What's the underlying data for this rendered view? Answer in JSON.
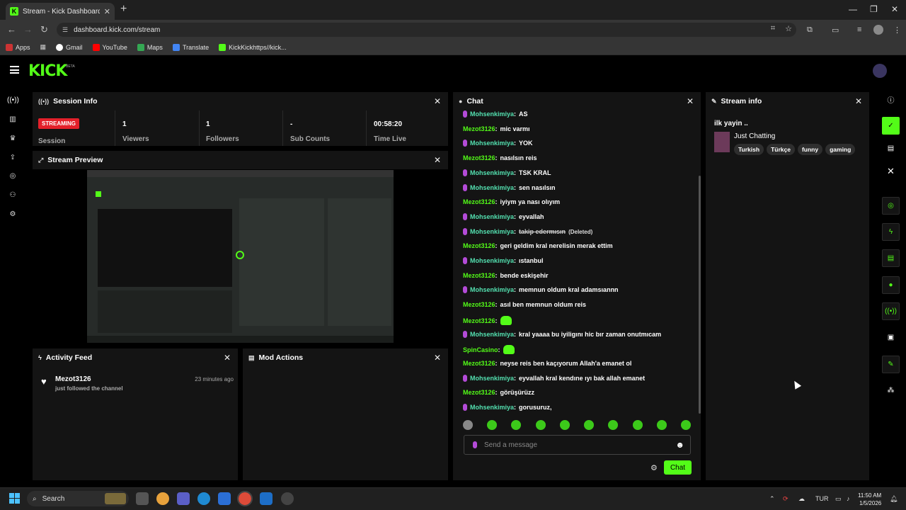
{
  "browser": {
    "tab_title": "Stream - Kick Dashboard",
    "tab_favicon": "K",
    "url": "dashboard.kick.com/stream",
    "bookmarks": [
      "Apps",
      "Gmail",
      "YouTube",
      "Maps",
      "Translate",
      "KickKickhttps//kick..."
    ]
  },
  "kick": {
    "logo": "KICK",
    "beta": "BETA"
  },
  "session": {
    "title": "Session Info",
    "badge": "STREAMING",
    "session_label": "Session",
    "stats": [
      {
        "value": "1",
        "label": "Viewers"
      },
      {
        "value": "1",
        "label": "Followers"
      },
      {
        "value": "-",
        "label": "Sub Counts"
      },
      {
        "value": "00:58:20",
        "label": "Time Live"
      }
    ]
  },
  "preview": {
    "title": "Stream Preview"
  },
  "activity": {
    "title": "Activity Feed",
    "items": [
      {
        "user": "Mezot3126",
        "text": "just followed the channel",
        "time": "23 minutes ago"
      }
    ]
  },
  "mod": {
    "title": "Mod Actions"
  },
  "chat": {
    "title": "Chat",
    "messages": [
      {
        "user": "Mohsenkimiya",
        "text": "AS",
        "mic": true
      },
      {
        "user": "Mezot3126",
        "text": "mic varmı",
        "mic": false
      },
      {
        "user": "Mohsenkimiya",
        "text": "YOK",
        "mic": true
      },
      {
        "user": "Mezot3126",
        "text": "nasılsın reis",
        "mic": false
      },
      {
        "user": "Mohsenkimiya",
        "text": "TSK KRAL",
        "mic": true
      },
      {
        "user": "Mohsenkimiya",
        "text": "sen nasılsın",
        "mic": true
      },
      {
        "user": "Mezot3126",
        "text": "iyiym ya nası olıyım",
        "mic": false
      },
      {
        "user": "Mohsenkimiya",
        "text": "eyvallah",
        "mic": true
      },
      {
        "user": "Mohsenkimiya",
        "text": "takip edermısın",
        "mic": true,
        "deleted": "(Deleted)"
      },
      {
        "user": "Mezot3126",
        "text": "geri geldim kral nerelisin merak ettim",
        "mic": false
      },
      {
        "user": "Mohsenkimiya",
        "text": "ıstanbul",
        "mic": true
      },
      {
        "user": "Mezot3126",
        "text": "bende eskişehir",
        "mic": false
      },
      {
        "user": "Mohsenkimiya",
        "text": "memnun oldum kral adamsıannn",
        "mic": true
      },
      {
        "user": "Mezot3126",
        "text": "asıl ben memnun oldum reis",
        "mic": false
      },
      {
        "user": "Mezot3126",
        "text": "",
        "mic": false,
        "emote": true
      },
      {
        "user": "Mohsenkimiya",
        "text": "kral yaaaa bu iyiligını hic bır zaman onutmıcam",
        "mic": true
      },
      {
        "user": "SpinCasino",
        "text": "",
        "mic": false,
        "emote": true
      },
      {
        "user": "Mezot3126",
        "text": "neyse reis ben kaçıyorum Allah'a emanet ol",
        "mic": false
      },
      {
        "user": "Mohsenkimiya",
        "text": "eyvallah kral kendıne ıyı bak allah emanet",
        "mic": true
      },
      {
        "user": "Mezot3126",
        "text": "görüşürüzz",
        "mic": false
      },
      {
        "user": "Mohsenkimiya",
        "text": "gorusuruz,",
        "mic": true
      }
    ],
    "placeholder": "Send a message",
    "send_label": "Chat"
  },
  "stream_info": {
    "title": "Stream info",
    "stream_title": "ilk yayin ..",
    "category": "Just Chatting",
    "tags": [
      "Turkish",
      "Türkçe",
      "funny",
      "gaming"
    ]
  },
  "taskbar": {
    "search": "Search",
    "lang": "TUR",
    "time": "11:50 AM",
    "date": "1/5/2026"
  },
  "colors": {
    "brand": "#53fc18",
    "streaming": "#e4202a",
    "mod_user": "#53e0b0"
  }
}
